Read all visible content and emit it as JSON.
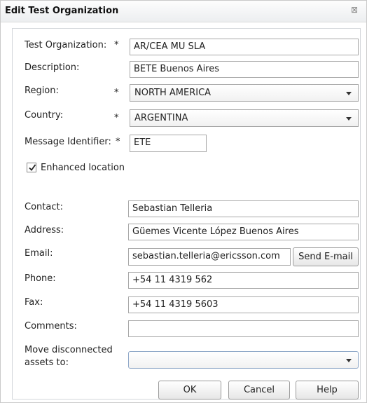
{
  "dialog": {
    "title": "Edit Test Organization",
    "close_glyph": "⊠"
  },
  "form": {
    "test_org": {
      "label": "Test Organization:",
      "value": "AR/CEA MU SLA",
      "required": "*"
    },
    "description": {
      "label": "Description:",
      "value": "BETE Buenos Aires"
    },
    "region": {
      "label": "Region:",
      "value": "NORTH AMERICA",
      "required": "*"
    },
    "country": {
      "label": "Country:",
      "value": "ARGENTINA",
      "required": "*"
    },
    "message_identifier": {
      "label": "Message Identifier:",
      "value": "ETE",
      "required": "*"
    },
    "enhanced_location": {
      "label": "Enhanced location",
      "checked": true
    },
    "contact": {
      "label": "Contact:",
      "value": "Sebastian Telleria"
    },
    "address": {
      "label": "Address:",
      "value": "Güemes Vicente López Buenos Aires"
    },
    "email": {
      "label": "Email:",
      "value": "sebastian.telleria@ericsson.com",
      "send_button": "Send E-mail"
    },
    "phone": {
      "label": "Phone:",
      "value": "+54 11 4319 562"
    },
    "fax": {
      "label": "Fax:",
      "value": "+54 11 4319 5603"
    },
    "comments": {
      "label": "Comments:",
      "value": ""
    },
    "move_disconnected": {
      "label_line1": "Move disconnected",
      "label_line2": "assets to:",
      "value": ""
    }
  },
  "buttons": {
    "ok": "OK",
    "cancel": "Cancel",
    "help": "Help"
  },
  "icons": {
    "check": "check-icon",
    "close": "close-icon",
    "dropdown": "chevron-down-icon"
  }
}
